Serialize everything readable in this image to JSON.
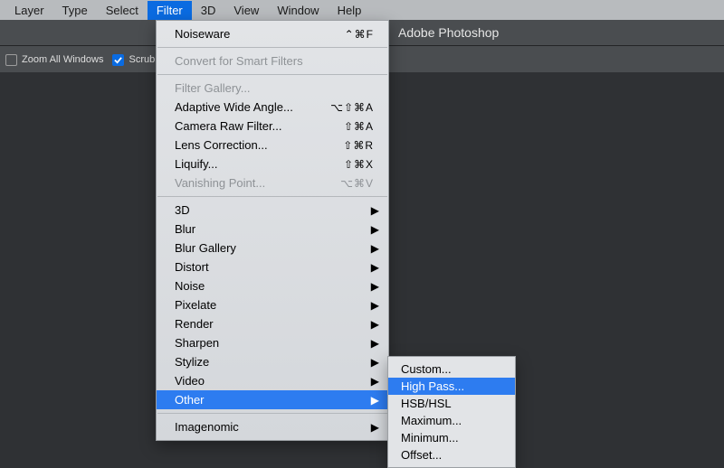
{
  "app_title": "Adobe Photoshop",
  "menubar": {
    "items": [
      "Layer",
      "Type",
      "Select",
      "Filter",
      "3D",
      "View",
      "Window",
      "Help"
    ],
    "active_index": 3
  },
  "optionsbar": {
    "zoom_all": {
      "label": "Zoom All Windows",
      "checked": false
    },
    "scrubby": {
      "label": "Scrubby Zoom",
      "checked": true
    }
  },
  "filter_menu": {
    "last_filter": {
      "label": "Noiseware",
      "shortcut": "⌃⌘F"
    },
    "convert_smart": "Convert for Smart Filters",
    "gallery_group": [
      {
        "label": "Filter Gallery...",
        "shortcut": "",
        "disabled": true,
        "submenu": false
      },
      {
        "label": "Adaptive Wide Angle...",
        "shortcut": "⌥⇧⌘A",
        "disabled": false,
        "submenu": false
      },
      {
        "label": "Camera Raw Filter...",
        "shortcut": "⇧⌘A",
        "disabled": false,
        "submenu": false
      },
      {
        "label": "Lens Correction...",
        "shortcut": "⇧⌘R",
        "disabled": false,
        "submenu": false
      },
      {
        "label": "Liquify...",
        "shortcut": "⇧⌘X",
        "disabled": false,
        "submenu": false
      },
      {
        "label": "Vanishing Point...",
        "shortcut": "⌥⌘V",
        "disabled": true,
        "submenu": false
      }
    ],
    "category_group": [
      "3D",
      "Blur",
      "Blur Gallery",
      "Distort",
      "Noise",
      "Pixelate",
      "Render",
      "Sharpen",
      "Stylize",
      "Video",
      "Other"
    ],
    "category_selected_index": 10,
    "plugin_group": [
      "Imagenomic"
    ]
  },
  "other_submenu": {
    "items": [
      "Custom...",
      "High Pass...",
      "HSB/HSL",
      "Maximum...",
      "Minimum...",
      "Offset..."
    ],
    "selected_index": 1
  }
}
